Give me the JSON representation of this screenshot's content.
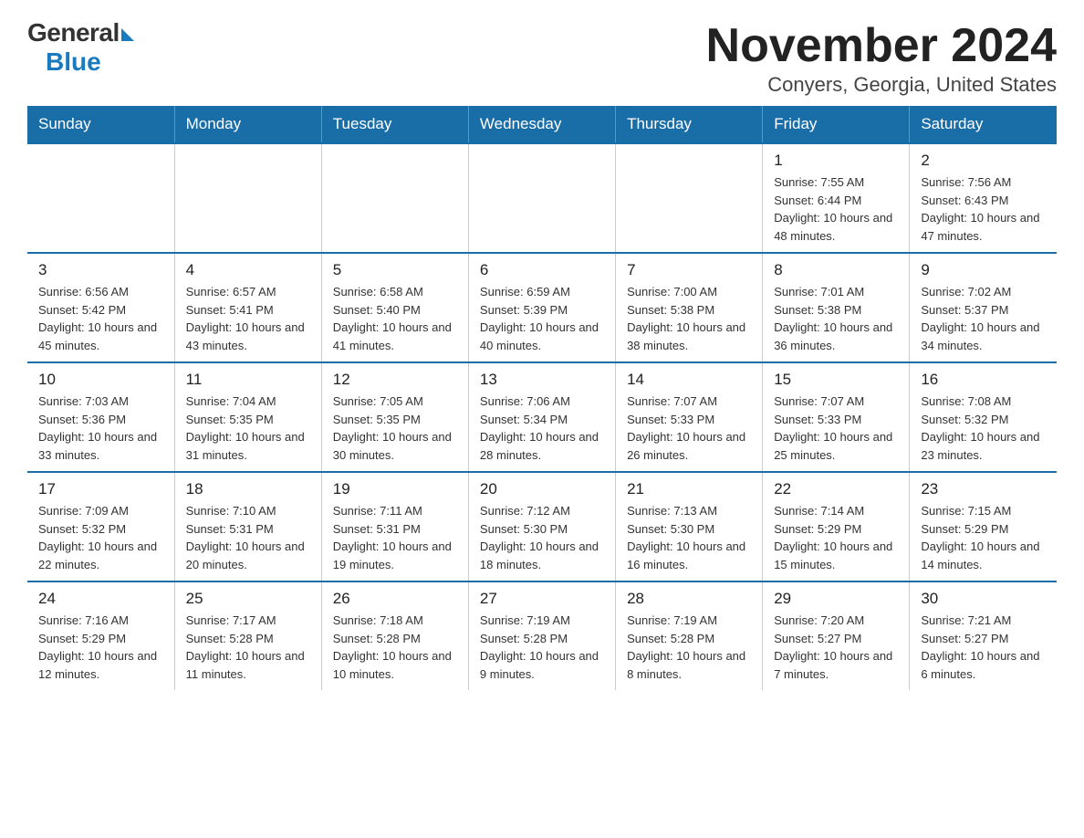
{
  "logo": {
    "general": "General",
    "blue": "Blue"
  },
  "title": "November 2024",
  "subtitle": "Conyers, Georgia, United States",
  "days_of_week": [
    "Sunday",
    "Monday",
    "Tuesday",
    "Wednesday",
    "Thursday",
    "Friday",
    "Saturday"
  ],
  "weeks": [
    [
      {
        "day": "",
        "info": ""
      },
      {
        "day": "",
        "info": ""
      },
      {
        "day": "",
        "info": ""
      },
      {
        "day": "",
        "info": ""
      },
      {
        "day": "",
        "info": ""
      },
      {
        "day": "1",
        "info": "Sunrise: 7:55 AM\nSunset: 6:44 PM\nDaylight: 10 hours and 48 minutes."
      },
      {
        "day": "2",
        "info": "Sunrise: 7:56 AM\nSunset: 6:43 PM\nDaylight: 10 hours and 47 minutes."
      }
    ],
    [
      {
        "day": "3",
        "info": "Sunrise: 6:56 AM\nSunset: 5:42 PM\nDaylight: 10 hours and 45 minutes."
      },
      {
        "day": "4",
        "info": "Sunrise: 6:57 AM\nSunset: 5:41 PM\nDaylight: 10 hours and 43 minutes."
      },
      {
        "day": "5",
        "info": "Sunrise: 6:58 AM\nSunset: 5:40 PM\nDaylight: 10 hours and 41 minutes."
      },
      {
        "day": "6",
        "info": "Sunrise: 6:59 AM\nSunset: 5:39 PM\nDaylight: 10 hours and 40 minutes."
      },
      {
        "day": "7",
        "info": "Sunrise: 7:00 AM\nSunset: 5:38 PM\nDaylight: 10 hours and 38 minutes."
      },
      {
        "day": "8",
        "info": "Sunrise: 7:01 AM\nSunset: 5:38 PM\nDaylight: 10 hours and 36 minutes."
      },
      {
        "day": "9",
        "info": "Sunrise: 7:02 AM\nSunset: 5:37 PM\nDaylight: 10 hours and 34 minutes."
      }
    ],
    [
      {
        "day": "10",
        "info": "Sunrise: 7:03 AM\nSunset: 5:36 PM\nDaylight: 10 hours and 33 minutes."
      },
      {
        "day": "11",
        "info": "Sunrise: 7:04 AM\nSunset: 5:35 PM\nDaylight: 10 hours and 31 minutes."
      },
      {
        "day": "12",
        "info": "Sunrise: 7:05 AM\nSunset: 5:35 PM\nDaylight: 10 hours and 30 minutes."
      },
      {
        "day": "13",
        "info": "Sunrise: 7:06 AM\nSunset: 5:34 PM\nDaylight: 10 hours and 28 minutes."
      },
      {
        "day": "14",
        "info": "Sunrise: 7:07 AM\nSunset: 5:33 PM\nDaylight: 10 hours and 26 minutes."
      },
      {
        "day": "15",
        "info": "Sunrise: 7:07 AM\nSunset: 5:33 PM\nDaylight: 10 hours and 25 minutes."
      },
      {
        "day": "16",
        "info": "Sunrise: 7:08 AM\nSunset: 5:32 PM\nDaylight: 10 hours and 23 minutes."
      }
    ],
    [
      {
        "day": "17",
        "info": "Sunrise: 7:09 AM\nSunset: 5:32 PM\nDaylight: 10 hours and 22 minutes."
      },
      {
        "day": "18",
        "info": "Sunrise: 7:10 AM\nSunset: 5:31 PM\nDaylight: 10 hours and 20 minutes."
      },
      {
        "day": "19",
        "info": "Sunrise: 7:11 AM\nSunset: 5:31 PM\nDaylight: 10 hours and 19 minutes."
      },
      {
        "day": "20",
        "info": "Sunrise: 7:12 AM\nSunset: 5:30 PM\nDaylight: 10 hours and 18 minutes."
      },
      {
        "day": "21",
        "info": "Sunrise: 7:13 AM\nSunset: 5:30 PM\nDaylight: 10 hours and 16 minutes."
      },
      {
        "day": "22",
        "info": "Sunrise: 7:14 AM\nSunset: 5:29 PM\nDaylight: 10 hours and 15 minutes."
      },
      {
        "day": "23",
        "info": "Sunrise: 7:15 AM\nSunset: 5:29 PM\nDaylight: 10 hours and 14 minutes."
      }
    ],
    [
      {
        "day": "24",
        "info": "Sunrise: 7:16 AM\nSunset: 5:29 PM\nDaylight: 10 hours and 12 minutes."
      },
      {
        "day": "25",
        "info": "Sunrise: 7:17 AM\nSunset: 5:28 PM\nDaylight: 10 hours and 11 minutes."
      },
      {
        "day": "26",
        "info": "Sunrise: 7:18 AM\nSunset: 5:28 PM\nDaylight: 10 hours and 10 minutes."
      },
      {
        "day": "27",
        "info": "Sunrise: 7:19 AM\nSunset: 5:28 PM\nDaylight: 10 hours and 9 minutes."
      },
      {
        "day": "28",
        "info": "Sunrise: 7:19 AM\nSunset: 5:28 PM\nDaylight: 10 hours and 8 minutes."
      },
      {
        "day": "29",
        "info": "Sunrise: 7:20 AM\nSunset: 5:27 PM\nDaylight: 10 hours and 7 minutes."
      },
      {
        "day": "30",
        "info": "Sunrise: 7:21 AM\nSunset: 5:27 PM\nDaylight: 10 hours and 6 minutes."
      }
    ]
  ]
}
